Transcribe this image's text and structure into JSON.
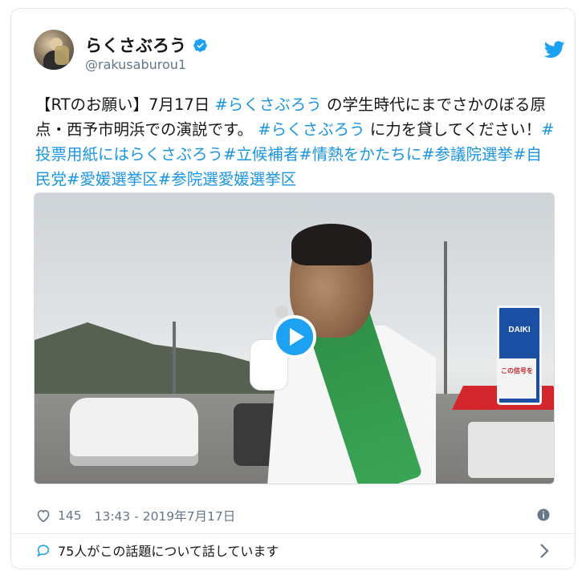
{
  "user": {
    "display_name": "らくさぶろう",
    "handle": "@rakusaburou1",
    "verified": true
  },
  "tweet": {
    "segments": [
      {
        "text": "【RTのお願い】7月17日 ",
        "tag": false
      },
      {
        "text": "#らくさぶろう",
        "tag": true
      },
      {
        "text": " の学生時代にまでさかのぼる原点・西予市明浜での演説です。 ",
        "tag": false
      },
      {
        "text": "#らくさぶろう",
        "tag": true
      },
      {
        "text": " に力を貸してください！",
        "tag": false
      },
      {
        "text": "#投票用紙にはらくさぶろう",
        "tag": true
      },
      {
        "text": "#立候補者",
        "tag": true
      },
      {
        "text": "#情熱をかたちに",
        "tag": true
      },
      {
        "text": "#参議院選挙",
        "tag": true
      },
      {
        "text": "#自民党",
        "tag": true
      },
      {
        "text": "#愛媛選挙区",
        "tag": true
      },
      {
        "text": "#参院選愛媛選挙区",
        "tag": true
      }
    ]
  },
  "media": {
    "sign_top": "DAIKI",
    "sign_bottom": "この信号を",
    "play_label": "play-video"
  },
  "meta": {
    "like_count": "145",
    "timestamp": "13:43 - 2019年7月17日"
  },
  "footer": {
    "replies_text": "75人がこの話題について話しています"
  },
  "colors": {
    "link": "#1b95e0",
    "twitter_blue": "#1da1f2",
    "muted": "#657786"
  },
  "icons": [
    "verified-badge-icon",
    "twitter-bird-icon",
    "play-icon",
    "heart-icon",
    "info-icon",
    "reply-bubble-icon",
    "chevron-right-icon"
  ]
}
